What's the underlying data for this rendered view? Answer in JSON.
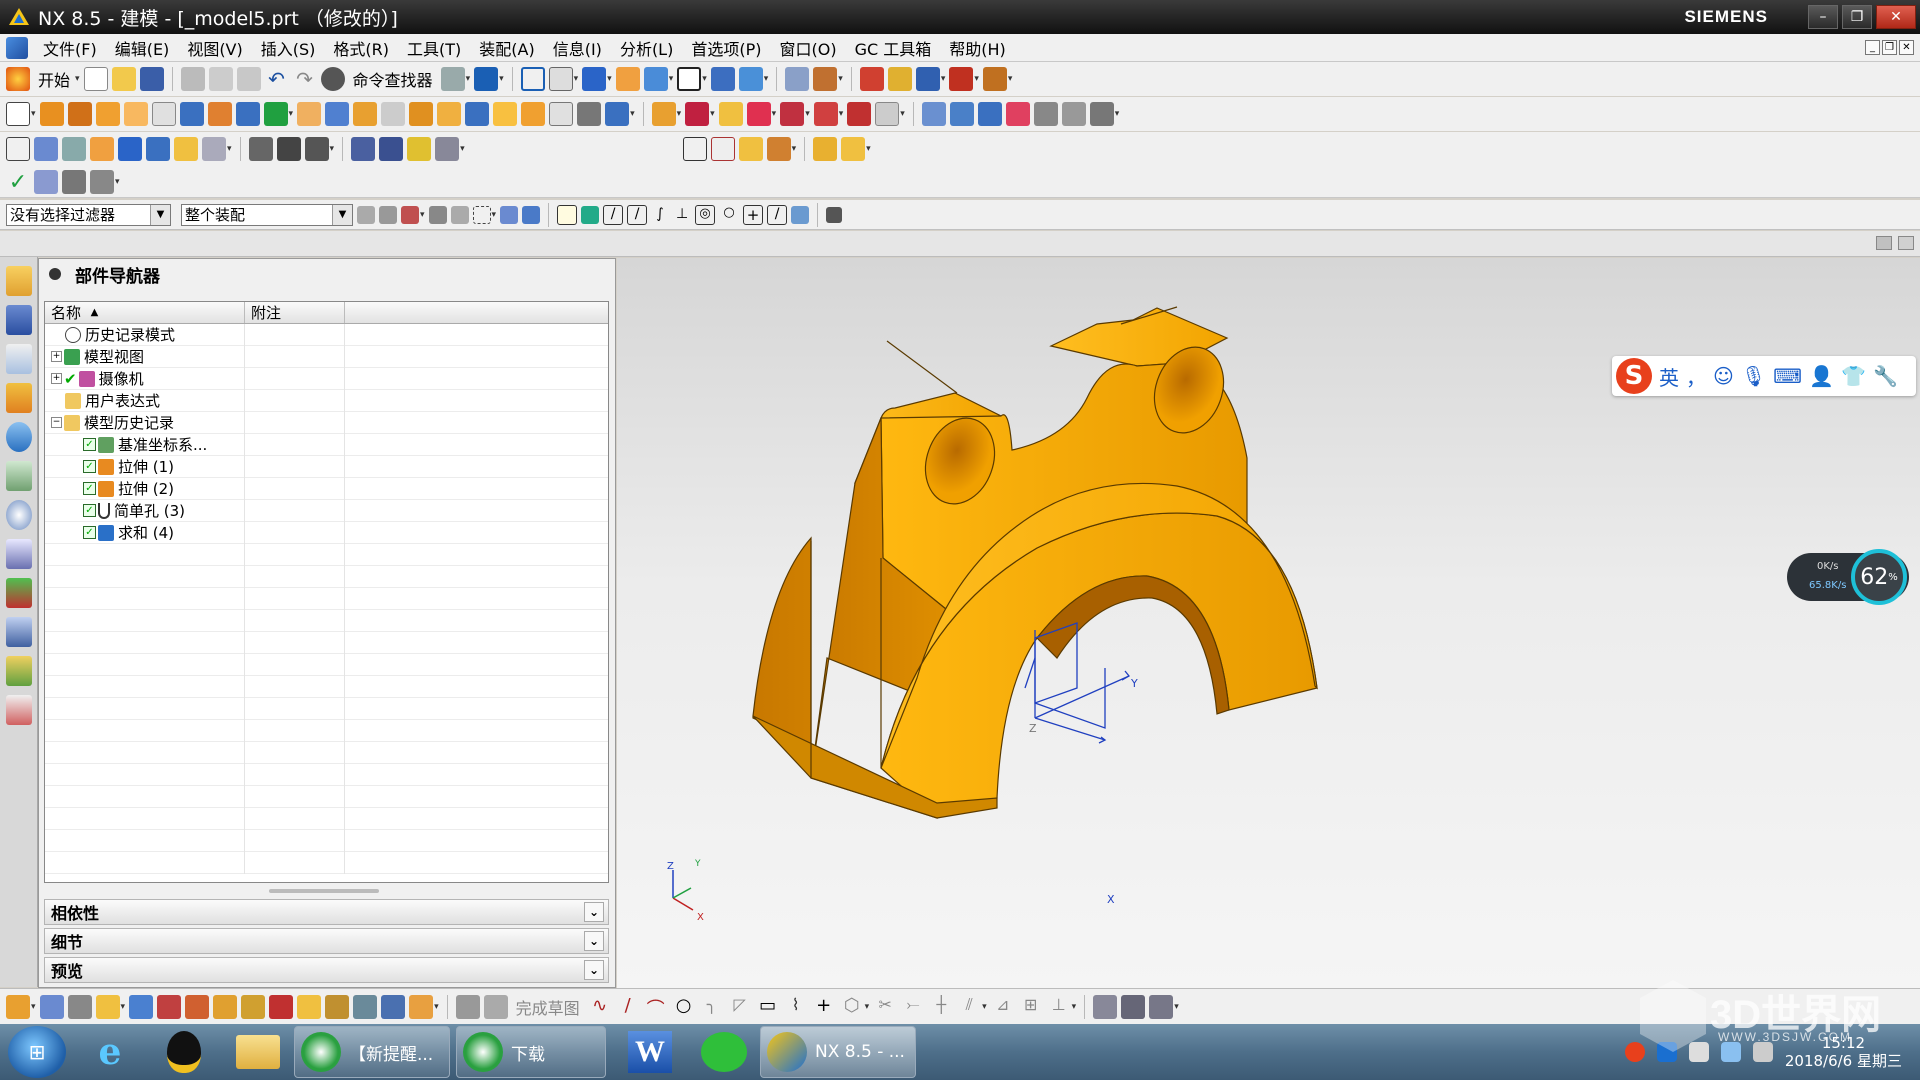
{
  "window": {
    "title": "NX 8.5 - 建模 - [_model5.prt （修改的）]",
    "brand": "SIEMENS"
  },
  "menu": [
    "文件(F)",
    "编辑(E)",
    "视图(V)",
    "插入(S)",
    "格式(R)",
    "工具(T)",
    "装配(A)",
    "信息(I)",
    "分析(L)",
    "首选项(P)",
    "窗口(O)",
    "GC 工具箱",
    "帮助(H)"
  ],
  "toolbar": {
    "start_label": "开始",
    "command_finder": "命令查找器"
  },
  "selection": {
    "filter_value": "没有选择过滤器",
    "scope_value": "整个装配"
  },
  "navigator": {
    "title": "部件导航器",
    "col_name": "名称",
    "col_note": "附注",
    "rows": [
      {
        "label": "历史记录模式"
      },
      {
        "label": "模型视图"
      },
      {
        "label": "摄像机"
      },
      {
        "label": "用户表达式"
      },
      {
        "label": "模型历史记录"
      },
      {
        "label": "基准坐标系..."
      },
      {
        "label": "拉伸 (1)"
      },
      {
        "label": "拉伸 (2)"
      },
      {
        "label": "简单孔 (3)"
      },
      {
        "label": "求和 (4)"
      }
    ],
    "sections": [
      "相依性",
      "细节",
      "预览"
    ]
  },
  "cue": {
    "finish_sketch": "完成草图"
  },
  "viewport": {
    "axis_labels": {
      "z": "Z",
      "y": "Y",
      "x": "X"
    },
    "model_color": "#f0a000"
  },
  "ime": {
    "lang": "英",
    "punct": "，"
  },
  "network": {
    "up": "0K/s",
    "down": "65.8K/s",
    "percent": "62",
    "percent_unit": "%"
  },
  "taskbar": {
    "tasks": [
      {
        "label": "【新提醒..."
      },
      {
        "label": "下载"
      },
      {
        "label": "NX 8.5 - ..."
      }
    ],
    "time": "15:12",
    "date": "2018/6/6 星期三"
  },
  "watermark": {
    "name": "3D世界网",
    "url": "WWW.3DSJW.COM"
  }
}
